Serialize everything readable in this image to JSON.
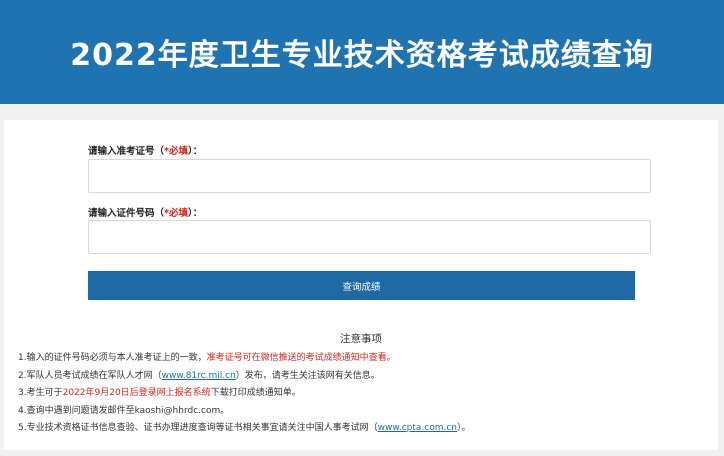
{
  "header": {
    "title": "2022年度卫生专业技术资格考试成绩查询"
  },
  "form": {
    "admission": {
      "label": "请输入准考证号",
      "req_open": "（",
      "req": "*必填",
      "req_close": "）：",
      "value": "",
      "placeholder": ""
    },
    "idcard": {
      "label": "请输入证件号码",
      "req_open": "（",
      "req": "*必填",
      "req_close": "）：",
      "value": "",
      "placeholder": ""
    },
    "submit_label": "查询成绩"
  },
  "notice": {
    "title": "注意事项",
    "line1": {
      "a": "1.输入的证件号码必须与本人准考证上的一致，",
      "b": "准考证号可在微信推送的考试成绩通知中查看。"
    },
    "line2": {
      "a": "2.军队人员考试成绩在军队人才网（",
      "link": "www.81rc.mil.cn",
      "b": "）发布，请考生关注该网有关信息。"
    },
    "line3": {
      "a": "3.考生可于",
      "b": "2022年9月20日后登录网上报名系统",
      "c": "下载打印成绩通知单。"
    },
    "line4": {
      "a": "4.查询中遇到问题请发邮件至kaoshi@hhrdc.com。"
    },
    "line5": {
      "a": "5.专业技术资格证书信息查验、证书办理进度查询等证书相关事宜请关注中国人事考试网（",
      "link": "www.cpta.com.cn",
      "b": "）。"
    }
  },
  "colors": {
    "header_bg": "#1f73b0",
    "button_bg": "#1f6aa5",
    "required": "#d9251c",
    "link": "#1f6aa5"
  }
}
